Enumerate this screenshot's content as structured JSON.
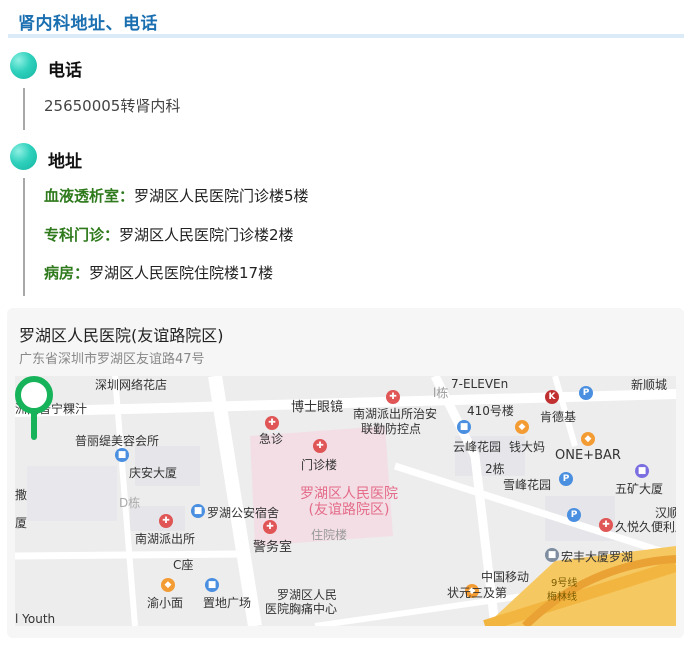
{
  "page": {
    "title": "肾内科地址、电话"
  },
  "phone": {
    "heading": "电话",
    "value": "25650005转肾内科"
  },
  "address": {
    "heading": "地址",
    "items": [
      {
        "label": "血液透析室：",
        "value": "罗湖区人民医院门诊楼5楼"
      },
      {
        "label": "专科门诊：",
        "value": "罗湖区人民医院门诊楼2楼"
      },
      {
        "label": "病房：",
        "value": "罗湖区人民医院住院楼17楼"
      }
    ]
  },
  "map": {
    "name": "罗湖区人民医院(友谊路院区)",
    "address": "广东省深圳市罗湖区友谊路47号",
    "hospital_label": [
      "罗湖区人民医院",
      "(友谊路院区)"
    ],
    "pois": [
      "深圳网络花店",
      "南湖派出所治安",
      "联勤防控点",
      "7-ELEVEn",
      "410号楼",
      "肯德基",
      "洲同普宁粿汁",
      "博士眼镜",
      "急诊",
      "门诊楼",
      "普丽缇美容会所",
      "云峰花园",
      "钱大妈",
      "ONE+BAR",
      "庆安大厦",
      "2栋",
      "雪峰花园",
      "五矿大厦",
      "D栋",
      "罗湖公安宿舍",
      "住院楼",
      "警务室",
      "汉顺",
      "久悦久便利店",
      "南湖派出所",
      "C座",
      "宏丰大厦罗湖",
      "罗湖区人民",
      "医院胸痛中心",
      "中国移动",
      "9号线",
      "梅林线",
      "渝小面",
      "置地广场",
      "状元三及第",
      "l Youth",
      "撒",
      "厦",
      "l栋",
      "新顺城"
    ]
  }
}
